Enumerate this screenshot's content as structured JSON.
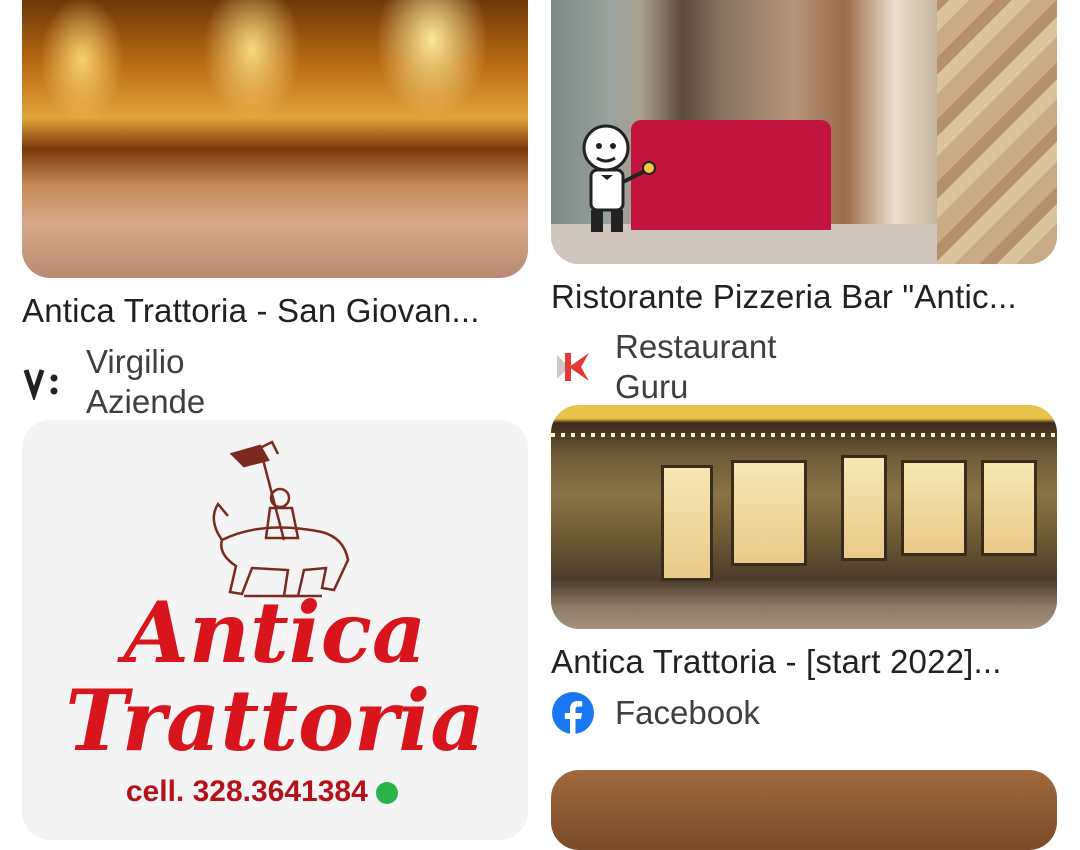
{
  "results": [
    {
      "title": "Antica Trattoria - San Giovan...",
      "source": "Virgilio Aziende",
      "source_icon": "virgilio-logo-icon"
    },
    {
      "title": "Ristorante Pizzeria Bar \"Antic...",
      "source": "Restaurant Guru",
      "source_icon": "restaurant-guru-logo-icon"
    },
    {
      "logo_line1": "Antica",
      "logo_line2": "Trattoria",
      "logo_phone": "cell. 328.3641384"
    },
    {
      "title": "Antica Trattoria - [start 2022]...",
      "source": "Facebook",
      "source_icon": "facebook-logo-icon"
    }
  ],
  "colors": {
    "logo_red": "#d8141c",
    "facebook_blue": "#1877f2",
    "guru_red": "#e53935"
  }
}
